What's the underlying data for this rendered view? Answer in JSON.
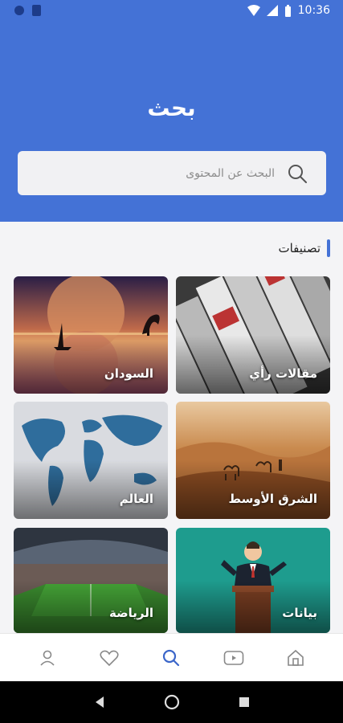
{
  "statusbar": {
    "time": "10:36"
  },
  "header": {
    "title": "بحث",
    "search_placeholder": "البحث عن المحتوى"
  },
  "section": {
    "title": "تصنيفات"
  },
  "categories": [
    {
      "label": "مقالات رأي"
    },
    {
      "label": "السودان"
    },
    {
      "label": "الشرق الأوسط"
    },
    {
      "label": "العالم"
    },
    {
      "label": "بيانات"
    },
    {
      "label": "الرياضة"
    }
  ],
  "bottom_nav": [
    "home-icon",
    "video-icon",
    "search-icon",
    "heart-icon",
    "profile-icon"
  ],
  "colors": {
    "primary": "#4472d6",
    "nav_active": "#3b66c9"
  }
}
